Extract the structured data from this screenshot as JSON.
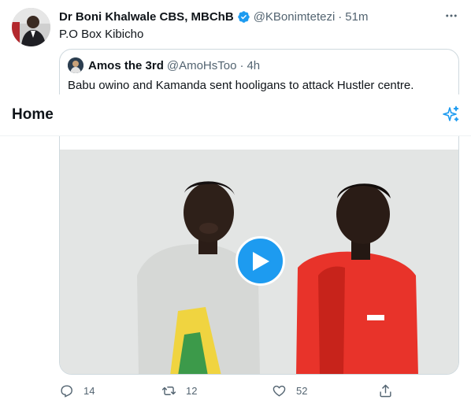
{
  "tweet": {
    "author_name": "Dr Boni Khalwale CBS, MBChB",
    "handle": "@KBonimtetezi",
    "separator": "·",
    "time": "51m",
    "text": "P.O Box Kibicho",
    "avatar_icon": "profile-photo",
    "verified_icon": "verified-badge-icon",
    "more_icon": "more-icon"
  },
  "quote": {
    "author_name": "Amos the 3rd",
    "handle": "@AmoHsToo",
    "separator": "·",
    "time": "4h",
    "text": "Babu owino and Kamanda sent hooligans to attack Hustler centre.",
    "text_partial": "...",
    "media": "video",
    "play_icon": "play-icon"
  },
  "header": {
    "title": "Home",
    "sparkle_icon": "sparkle-icon"
  },
  "actions": {
    "replies": "14",
    "retweets": "12",
    "likes": "52",
    "reply_icon": "reply-icon",
    "retweet_icon": "retweet-icon",
    "like_icon": "heart-icon",
    "share_icon": "share-icon"
  },
  "colors": {
    "accent": "#1d9bf0",
    "text": "#0f1419",
    "secondary_text": "#536471",
    "border": "#cfd9de"
  }
}
